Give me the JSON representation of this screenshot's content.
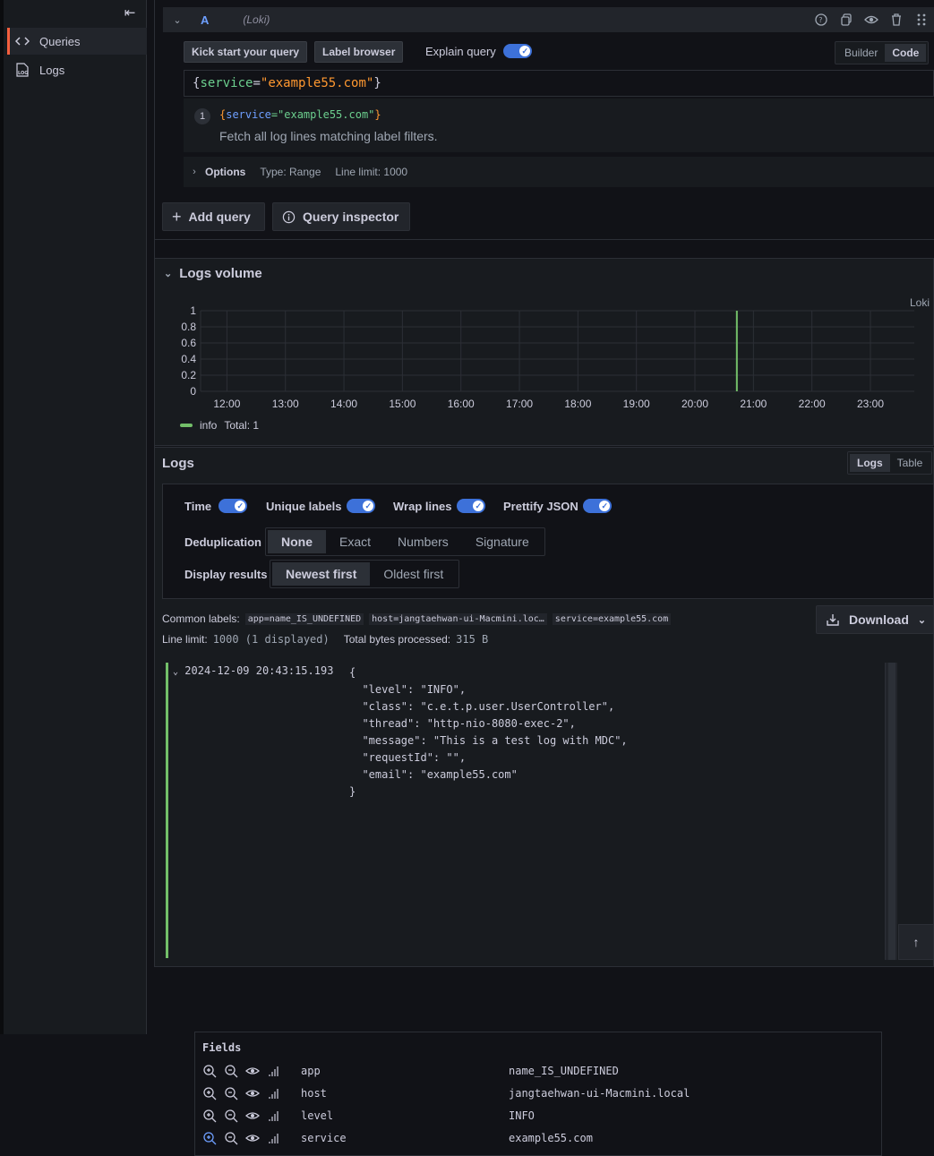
{
  "sidebar": {
    "items": [
      {
        "label": "Queries",
        "icon": "code-icon",
        "active": true
      },
      {
        "label": "Logs",
        "icon": "logs-icon",
        "active": false
      }
    ]
  },
  "query": {
    "ref_id": "A",
    "datasource": "(Loki)",
    "kick_start_label": "Kick start your query",
    "label_browser_label": "Label browser",
    "explain_label": "Explain query",
    "explain_on": true,
    "mode_options": [
      "Builder",
      "Code"
    ],
    "mode_selected": "Code",
    "expr_open": "{",
    "expr_key": "service",
    "expr_eq": "=",
    "expr_value": "\"example55.com\"",
    "expr_close": "}",
    "explain_step": "1",
    "explain_code_open": "{",
    "explain_code_key": "service",
    "explain_code_value": "=\"example55.com\"",
    "explain_code_close": "}",
    "explain_text": "Fetch all log lines matching label filters.",
    "options_title": "Options",
    "options_type": "Type: Range",
    "options_limit": "Line limit: 1000",
    "add_query_label": "Add query",
    "query_inspector_label": "Query inspector"
  },
  "volume": {
    "title": "Logs volume",
    "datasource_tag": "Loki",
    "legend_label": "info",
    "legend_total": "Total: 1"
  },
  "chart_data": {
    "type": "bar",
    "title": "",
    "x_ticks": [
      "12:00",
      "13:00",
      "14:00",
      "15:00",
      "16:00",
      "17:00",
      "18:00",
      "19:00",
      "20:00",
      "21:00",
      "22:00",
      "23:00"
    ],
    "y_ticks": [
      "0",
      "0.2",
      "0.4",
      "0.6",
      "0.8",
      "1"
    ],
    "ylim": [
      0,
      1
    ],
    "xlim_hours": [
      11.55,
      23.75
    ],
    "series": [
      {
        "name": "info",
        "color": "#73bf69",
        "points": [
          {
            "x": "20:43",
            "y": 1
          }
        ]
      }
    ],
    "grid": true,
    "legend": "bottom-left"
  },
  "logs": {
    "title": "Logs",
    "view_options": [
      "Logs",
      "Table"
    ],
    "view_selected": "Logs",
    "toggles": [
      {
        "label": "Time",
        "on": true
      },
      {
        "label": "Unique labels",
        "on": true
      },
      {
        "label": "Wrap lines",
        "on": true
      },
      {
        "label": "Prettify JSON",
        "on": true
      }
    ],
    "dedup_label": "Deduplication",
    "dedup_options": [
      "None",
      "Exact",
      "Numbers",
      "Signature"
    ],
    "dedup_selected": "None",
    "display_label": "Display results",
    "display_options": [
      "Newest first",
      "Oldest first"
    ],
    "display_selected": "Newest first",
    "common_labels_label": "Common labels:",
    "common_labels": [
      "app=name_IS_UNDEFINED",
      "host=jangtaehwan-ui-Macmini.loc…",
      "service=example55.com"
    ],
    "line_limit_label": "Line limit:",
    "line_limit_value": "1000 (1 displayed)",
    "bytes_label": "Total bytes processed:",
    "bytes_value": "315 B",
    "download_label": "Download",
    "entry": {
      "timestamp": "2024-12-09 20:43:15.193",
      "body": "{\n  \"level\": \"INFO\",\n  \"class\": \"c.e.t.p.user.UserController\",\n  \"thread\": \"http-nio-8080-exec-2\",\n  \"message\": \"This is a test log with MDC\",\n  \"requestId\": \"\",\n  \"email\": \"example55.com\"\n}"
    },
    "fields_title": "Fields",
    "fields": [
      {
        "key": "app",
        "value": "name_IS_UNDEFINED"
      },
      {
        "key": "host",
        "value": "jangtaehwan-ui-Macmini.local"
      },
      {
        "key": "level",
        "value": "INFO"
      },
      {
        "key": "service",
        "value": "example55.com"
      }
    ]
  }
}
